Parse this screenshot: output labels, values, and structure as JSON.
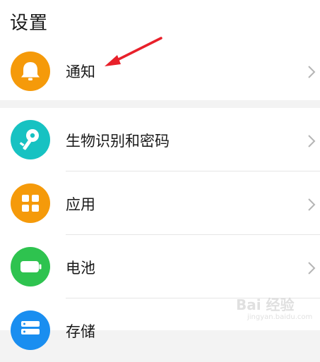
{
  "page": {
    "title": "设置"
  },
  "colors": {
    "notification": "#f59a0a",
    "biometrics": "#17c2c2",
    "apps": "#f59a0a",
    "battery": "#2ec34f",
    "storage": "#1a8ef0",
    "annotation_arrow": "#e8202a"
  },
  "items": [
    {
      "label": "通知",
      "icon": "bell-icon"
    },
    {
      "label": "生物识别和密码",
      "icon": "key-icon"
    },
    {
      "label": "应用",
      "icon": "grid-icon"
    },
    {
      "label": "电池",
      "icon": "battery-icon"
    },
    {
      "label": "存储",
      "icon": "storage-icon"
    }
  ],
  "watermark": {
    "brand": "Bai 经验",
    "url": "jingyan.baidu.com"
  }
}
